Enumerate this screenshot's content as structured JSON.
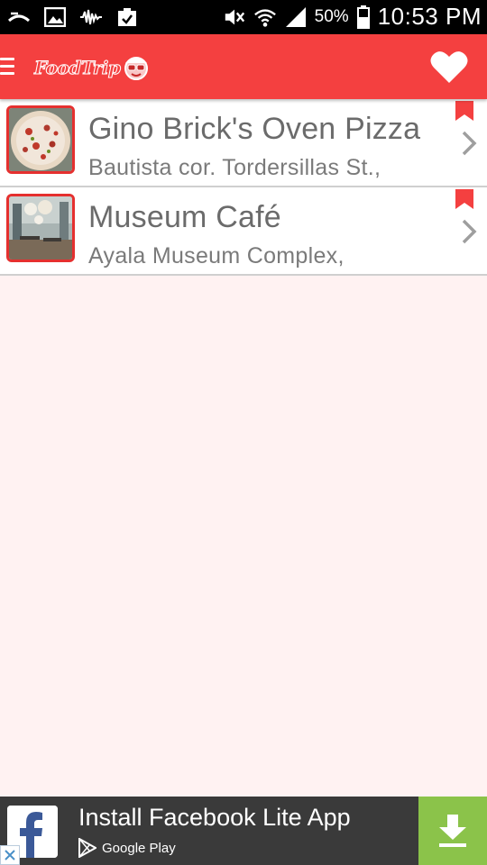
{
  "status_bar": {
    "battery_percent": "50%",
    "time": "10:53 PM"
  },
  "app_bar": {
    "logo_text": "FoodTrip",
    "accent_color": "#f44040"
  },
  "restaurants": [
    {
      "name": "Gino Brick's Oven Pizza",
      "address": "Bautista cor. Tordersillas St.,",
      "thumbnail": "pizza"
    },
    {
      "name": "Museum Café",
      "address": "Ayala Museum Complex,",
      "thumbnail": "cafe-interior"
    }
  ],
  "ad": {
    "title": "Install Facebook Lite App",
    "store_label": "Google Play",
    "download_color": "#8bc34a"
  },
  "icons": {
    "status_left": [
      "missed-call-icon",
      "image-icon",
      "voicemail-icon",
      "clipboard-check-icon"
    ],
    "status_right": [
      "mute-icon",
      "wifi-icon",
      "signal-icon",
      "battery-icon"
    ]
  }
}
